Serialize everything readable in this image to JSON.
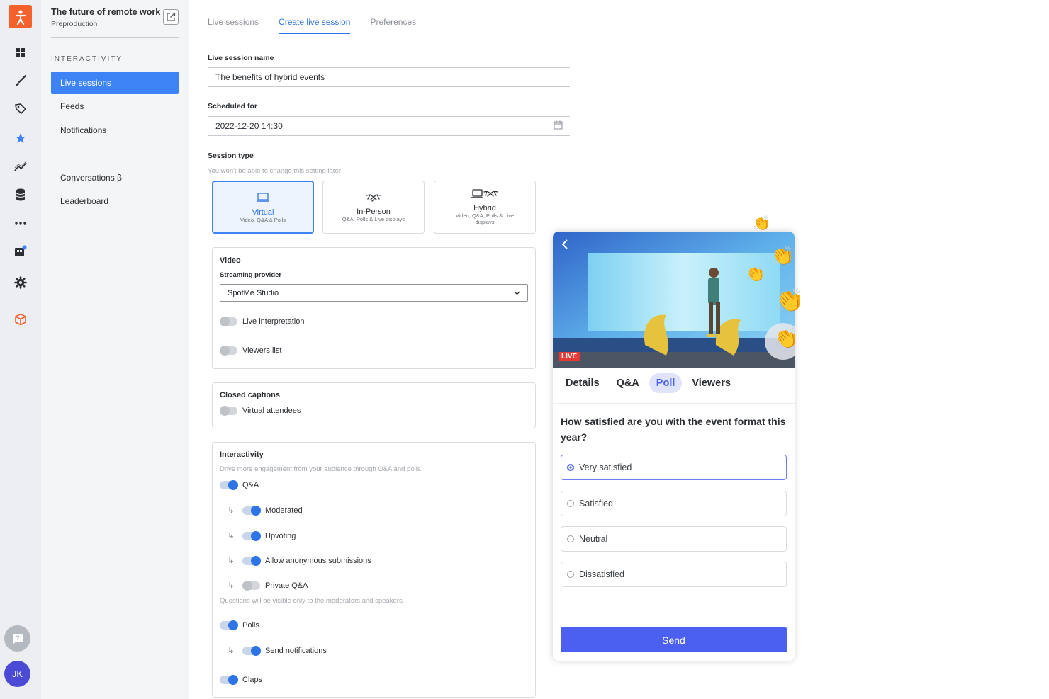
{
  "side": {
    "event_title": "The future of remote work ...",
    "event_phase": "Preproduction",
    "section_label": "INTERACTIVITY",
    "items": [
      "Live sessions",
      "Feeds",
      "Notifications",
      "Conversations β",
      "Leaderboard"
    ]
  },
  "rail": {
    "avatar_initials": "JK"
  },
  "tabs": [
    "Live sessions",
    "Create live session",
    "Preferences"
  ],
  "form": {
    "name_label": "Live session name",
    "name_value": "The benefits of hybrid events",
    "schedule_label": "Scheduled for",
    "schedule_value": "2022-12-20 14:30",
    "type_label": "Session type",
    "type_hint": "You won't be able to change this setting later",
    "types": [
      {
        "name": "Virtual",
        "desc": "Video, Q&A & Polls"
      },
      {
        "name": "In-Person",
        "desc": "Q&A, Polls & Live displays"
      },
      {
        "name": "Hybrid",
        "desc": "Video, Q&A, Polls & Live displays"
      }
    ]
  },
  "video": {
    "title": "Video",
    "provider_label": "Streaming provider",
    "provider_value": "SpotMe Studio",
    "live_interpretation": "Live interpretation",
    "viewers_list": "Viewers list"
  },
  "captions": {
    "title": "Closed captions",
    "virtual_attendees": "Virtual attendees"
  },
  "interactivity": {
    "title": "Interactivity",
    "desc": "Drive more engagement from your audience through Q&A and polls.",
    "qa": "Q&A",
    "moderated": "Moderated",
    "upvoting": "Upvoting",
    "anonymous": "Allow anonymous submissions",
    "private_qa": "Private Q&A",
    "private_hint": "Questions will be visible only to the moderators and speakers.",
    "polls": "Polls",
    "send_notifications": "Send notifications",
    "claps": "Claps"
  },
  "preview": {
    "live_badge": "LIVE",
    "tabs": [
      "Details",
      "Q&A",
      "Poll",
      "Viewers"
    ],
    "question": "How satisfied are you with the event format this year?",
    "options": [
      "Very satisfied",
      "Satisfied",
      "Neutral",
      "Dissatisfied"
    ],
    "send_label": "Send"
  },
  "colors": {
    "accent": "#3d83f5",
    "brand": "#f4612c",
    "send": "#4b5ff1"
  }
}
